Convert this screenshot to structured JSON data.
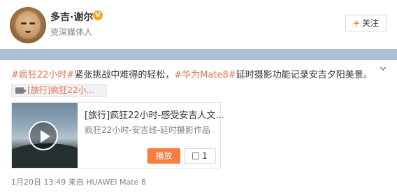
{
  "header": {
    "username": "多吉·谢尔",
    "verified_badge": "V",
    "subtitle": "资深媒体人",
    "follow": {
      "plus": "+",
      "label": "关注"
    }
  },
  "post": {
    "tag1": "#疯狂22小时#",
    "text1": "紧张挑战中难得的轻松，",
    "tag2": "#华为Mate8#",
    "text2": "延时摄影功能记录安吉夕阳美景。"
  },
  "video_link": {
    "label": "[旅行]疯狂22小..."
  },
  "card": {
    "title": "[旅行]疯狂22小时-感受安吉人文...",
    "subtitle": "疯狂22小时-安吉线-延时摄影作品",
    "play_label": "播放",
    "like_count": "1"
  },
  "footer": {
    "time": "1月20日 13:49",
    "from": "来自",
    "device": "HUAWEI Mate 8"
  },
  "icons": {
    "chevron": "chevron-down-icon",
    "camera": "video-camera-icon",
    "thumb": "thumbs-up-icon"
  },
  "colors": {
    "accent_orange": "#f77c3d",
    "link_orange": "#eb7350",
    "divider_blue": "#acbfd5",
    "verified_yellow": "#f5a623"
  }
}
